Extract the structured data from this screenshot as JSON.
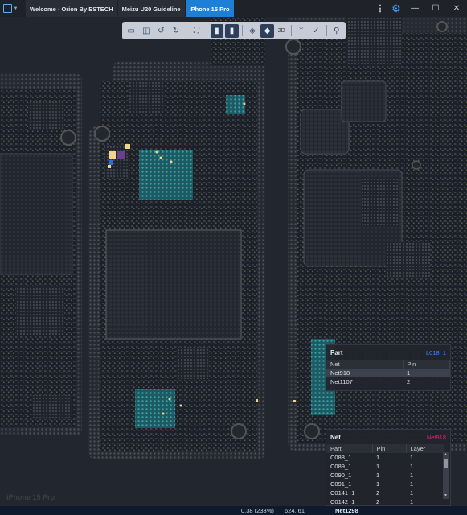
{
  "titlebar": {
    "tabs": [
      {
        "label": "Welcome - Orion By ESTECH",
        "active": false
      },
      {
        "label": "Meizu U20 Guideline",
        "active": false
      },
      {
        "label": "iPhone 15 Pro",
        "active": true
      }
    ],
    "menu_glyph": "⋮",
    "gear_glyph": "⚙",
    "min_glyph": "—",
    "max_glyph": "☐",
    "close_glyph": "✕"
  },
  "toolbar": {
    "icons": [
      "fit-board-icon",
      "split-view-icon",
      "rotate-left-icon",
      "rotate-right-icon",
      "fullscreen-icon",
      "top-side-icon",
      "bottom-side-icon",
      "layers-icon",
      "diode-icon",
      "net-trace-icon",
      "check-icon",
      "search-icon"
    ],
    "two_d_label": "2D"
  },
  "part_panel": {
    "title": "Part",
    "part_id": "L018_1",
    "part_id_color": "#2d8cff",
    "columns": [
      "Net",
      "Pin"
    ],
    "rows": [
      {
        "net": "Net918",
        "pin": "1"
      },
      {
        "net": "Net1107",
        "pin": "2"
      }
    ]
  },
  "net_panel": {
    "title": "Net",
    "net_id": "Net918",
    "net_id_color": "#e0207a",
    "columns": [
      "Part",
      "Pin",
      "Layer"
    ],
    "rows": [
      {
        "part": "C088_1",
        "pin": "1",
        "layer": "1"
      },
      {
        "part": "C089_1",
        "pin": "1",
        "layer": "1"
      },
      {
        "part": "C090_1",
        "pin": "1",
        "layer": "1"
      },
      {
        "part": "C091_1",
        "pin": "1",
        "layer": "1"
      },
      {
        "part": "C0141_1",
        "pin": "2",
        "layer": "1"
      },
      {
        "part": "C0142_1",
        "pin": "2",
        "layer": "1"
      }
    ]
  },
  "watermark": "iPhone 15 Pro",
  "status": {
    "zoom": "0.38 (233%)",
    "coords": "624, 61",
    "net": "Net1298"
  }
}
